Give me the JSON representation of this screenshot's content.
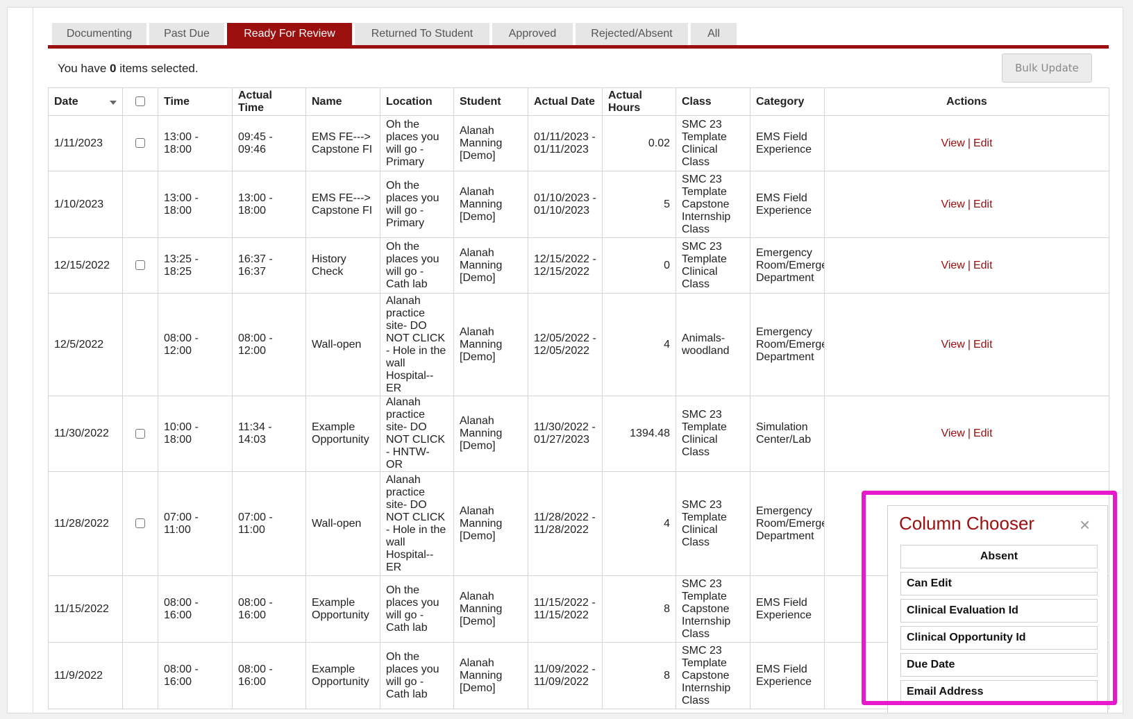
{
  "tabs": [
    {
      "label": "Documenting",
      "active": false
    },
    {
      "label": "Past Due",
      "active": false
    },
    {
      "label": "Ready For Review",
      "active": true
    },
    {
      "label": "Returned To Student",
      "active": false
    },
    {
      "label": "Approved",
      "active": false
    },
    {
      "label": "Rejected/Absent",
      "active": false
    },
    {
      "label": "All",
      "active": false
    }
  ],
  "selection": {
    "prefix": "You have",
    "count": "0",
    "suffix": "items selected."
  },
  "bulk_update_label": "Bulk Update",
  "columns": [
    "Date",
    "",
    "Time",
    "Actual Time",
    "Name",
    "Location",
    "Student",
    "Actual Date",
    "Actual Hours",
    "Class",
    "Category",
    "Actions"
  ],
  "rows": [
    {
      "date": "1/11/2023",
      "checkbox": true,
      "time": "13:00 - 18:00",
      "actual_time": "09:45 - 09:46",
      "name": "EMS FE---> Capstone FI",
      "location": "Oh the places you will go - Primary",
      "student": "Alanah Manning [Demo]",
      "actual_date": "01/11/2023 - 01/11/2023",
      "actual_hours": "0.02",
      "class": "SMC 23 Template Clinical Class",
      "category": "EMS Field Experience",
      "view": "View",
      "edit": "Edit"
    },
    {
      "date": "1/10/2023",
      "checkbox": false,
      "time": "13:00 - 18:00",
      "actual_time": "13:00 - 18:00",
      "name": "EMS FE---> Capstone FI",
      "location": "Oh the places you will go - Primary",
      "student": "Alanah Manning [Demo]",
      "actual_date": "01/10/2023 - 01/10/2023",
      "actual_hours": "5",
      "class": "SMC 23 Template Capstone Internship Class",
      "category": "EMS Field Experience",
      "view": "View",
      "edit": "Edit"
    },
    {
      "date": "12/15/2022",
      "checkbox": true,
      "time": "13:25 - 18:25",
      "actual_time": "16:37 - 16:37",
      "name": "History Check",
      "location": "Oh the places you will go - Cath lab",
      "student": "Alanah Manning [Demo]",
      "actual_date": "12/15/2022 - 12/15/2022",
      "actual_hours": "0",
      "class": "SMC 23 Template Clinical Class",
      "category": "Emergency Room/Emergency Department",
      "view": "View",
      "edit": "Edit"
    },
    {
      "date": "12/5/2022",
      "checkbox": false,
      "time": "08:00 - 12:00",
      "actual_time": "08:00 - 12:00",
      "name": "Wall-open",
      "location": "Alanah practice site- DO NOT CLICK - Hole in the wall Hospital-- ER",
      "student": "Alanah Manning [Demo]",
      "actual_date": "12/05/2022 - 12/05/2022",
      "actual_hours": "4",
      "class": "Animals- woodland",
      "category": "Emergency Room/Emergency Department",
      "view": "View",
      "edit": "Edit"
    },
    {
      "date": "11/30/2022",
      "checkbox": true,
      "time": "10:00 - 18:00",
      "actual_time": "11:34 - 14:03",
      "name": "Example Opportunity",
      "location": "Alanah practice site- DO NOT CLICK - HNTW- OR",
      "student": "Alanah Manning [Demo]",
      "actual_date": "11/30/2022 - 01/27/2023",
      "actual_hours": "1394.48",
      "class": "SMC 23 Template Clinical Class",
      "category": "Simulation Center/Lab",
      "view": "View",
      "edit": "Edit"
    },
    {
      "date": "11/28/2022",
      "checkbox": true,
      "time": "07:00 - 11:00",
      "actual_time": "07:00 - 11:00",
      "name": "Wall-open",
      "location": "Alanah practice site- DO NOT CLICK - Hole in the wall Hospital-- ER",
      "student": "Alanah Manning [Demo]",
      "actual_date": "11/28/2022 - 11/28/2022",
      "actual_hours": "4",
      "class": "SMC 23 Template Clinical Class",
      "category": "Emergency Room/Emergency Department",
      "view": "",
      "edit": ""
    },
    {
      "date": "11/15/2022",
      "checkbox": false,
      "time": "08:00 - 16:00",
      "actual_time": "08:00 - 16:00",
      "name": "Example Opportunity",
      "location": "Oh the places you will go - Cath lab",
      "student": "Alanah Manning [Demo]",
      "actual_date": "11/15/2022 - 11/15/2022",
      "actual_hours": "8",
      "class": "SMC 23 Template Capstone Internship Class",
      "category": "EMS Field Experience",
      "view": "",
      "edit": ""
    },
    {
      "date": "11/9/2022",
      "checkbox": false,
      "time": "08:00 - 16:00",
      "actual_time": "08:00 - 16:00",
      "name": "Example Opportunity",
      "location": "Oh the places you will go - Cath lab",
      "student": "Alanah Manning [Demo]",
      "actual_date": "11/09/2022 - 11/09/2022",
      "actual_hours": "8",
      "class": "SMC 23 Template Capstone Internship Class",
      "category": "EMS Field Experience",
      "view": "",
      "edit": ""
    }
  ],
  "column_chooser": {
    "title": "Column Chooser",
    "close_icon": "×",
    "items": [
      "Absent",
      "Can Edit",
      "Clinical Evaluation Id",
      "Clinical Opportunity Id",
      "Due Date",
      "Email Address"
    ]
  },
  "colors": {
    "brand": "#9b0f0f",
    "link": "#a00d0d",
    "highlight": "#e61acb"
  }
}
